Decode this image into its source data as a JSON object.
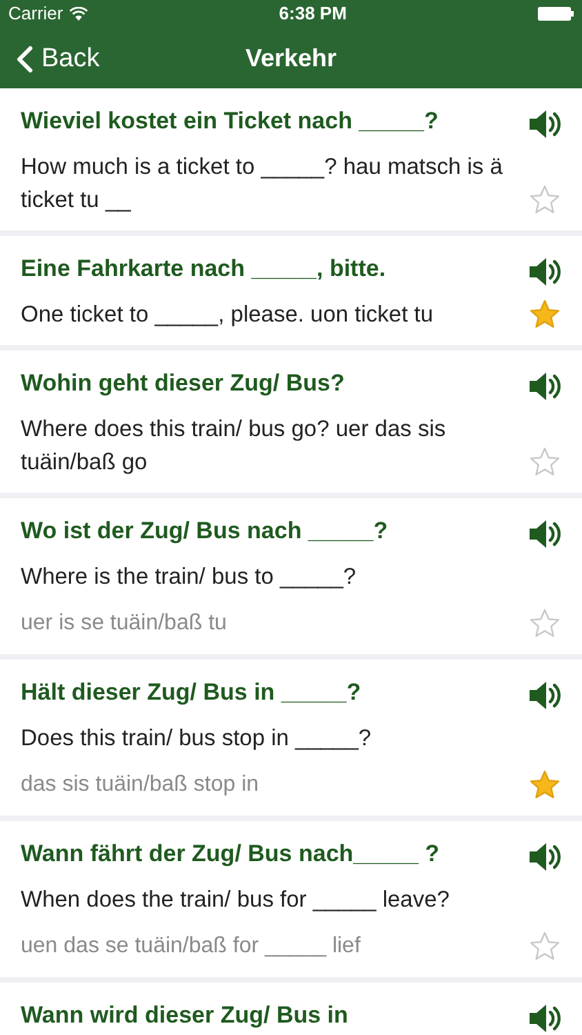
{
  "status_bar": {
    "carrier": "Carrier",
    "time": "6:38 PM"
  },
  "nav": {
    "back": "Back",
    "title": "Verkehr"
  },
  "phrases": [
    {
      "german": "Wieviel kostet ein Ticket nach _____?",
      "english": "How much is a ticket to _____? hau matsch is ä ticket tu __",
      "starred": false
    },
    {
      "german": "Eine Fahrkarte nach _____, bitte.",
      "english": "One ticket to _____, please. uon ticket tu",
      "starred": true
    },
    {
      "german": "Wohin geht dieser Zug/ Bus?",
      "english": "Where does this train/ bus go? uer das sis tuäin/baß go",
      "starred": false
    },
    {
      "german": "Wo ist der Zug/ Bus nach _____?",
      "english": "Where is the train/ bus to _____?",
      "pronunciation": "uer is se tuäin/baß tu",
      "starred": false
    },
    {
      "german": "Hält dieser Zug/ Bus in _____?",
      "english": "Does this train/ bus stop in _____?",
      "pronunciation": "das sis tuäin/baß stop in",
      "starred": true
    },
    {
      "german": "Wann fährt der Zug/ Bus nach_____ ?",
      "english": "When does the train/ bus for _____ leave?",
      "pronunciation": "uen das se tuäin/baß for _____ lief",
      "starred": false
    },
    {
      "german": "Wann wird dieser Zug/ Bus in"
    }
  ]
}
